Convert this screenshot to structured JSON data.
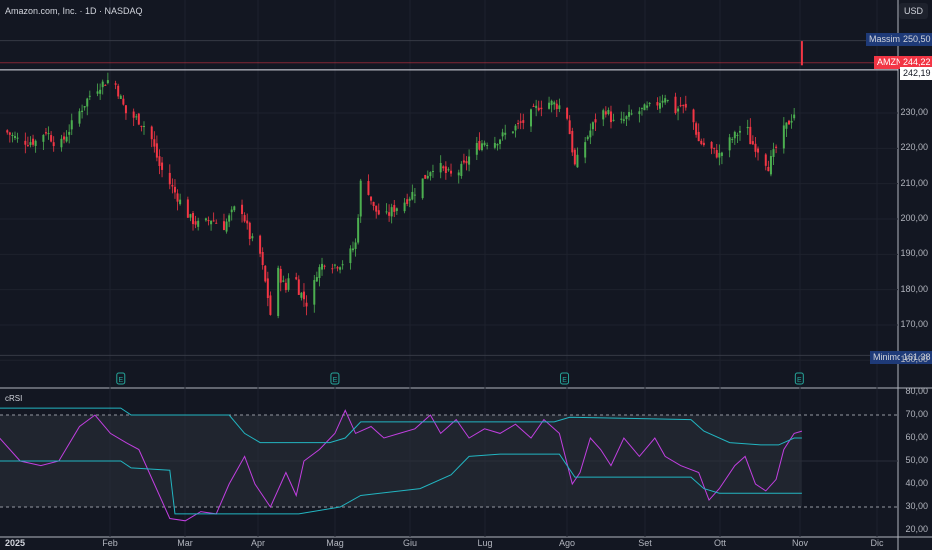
{
  "header": {
    "title": "Amazon.com, Inc. · 1D · NASDAQ",
    "currency": "USD"
  },
  "tags": {
    "high_label": "Massimo",
    "high_value": "250,50",
    "symbol": "AMZN",
    "last_value": "244,22",
    "prev_value": "242,19",
    "low_label": "Minimo",
    "low_value": "161,38"
  },
  "earnings_marker": "E",
  "indicator": {
    "name": "cRSI"
  },
  "colors": {
    "up": "#4caf50",
    "down": "#f23645",
    "crsi": "#c13fe0",
    "bands": "#22b5c1",
    "bg": "#131722"
  },
  "chart_data": [
    {
      "type": "candlestick",
      "title": "Amazon.com, Inc. · 1D · NASDAQ",
      "x_unit": "days since 2025-01-01 (approx)",
      "ylim": [
        158,
        254
      ],
      "y_ticks": [
        "230,00",
        "220,00",
        "210,00",
        "200,00",
        "190,00",
        "180,00",
        "170,00",
        "160,00"
      ],
      "x_ticks": [
        "2025",
        "Feb",
        "Mar",
        "Apr",
        "Mag",
        "Giu",
        "Lug",
        "Ago",
        "Set",
        "Ott",
        "Nov",
        "Dic"
      ],
      "close_path": [
        [
          -4,
          225
        ],
        [
          2,
          222
        ],
        [
          8,
          222
        ],
        [
          12,
          225
        ],
        [
          17,
          220
        ],
        [
          23,
          228
        ],
        [
          29,
          235
        ],
        [
          33,
          238
        ],
        [
          38,
          240
        ],
        [
          40,
          236
        ],
        [
          43,
          230
        ],
        [
          48,
          228
        ],
        [
          52,
          225
        ],
        [
          56,
          215
        ],
        [
          60,
          210
        ],
        [
          64,
          205
        ],
        [
          68,
          200
        ],
        [
          72,
          198
        ],
        [
          76,
          200
        ],
        [
          81,
          198
        ],
        [
          87,
          205
        ],
        [
          91,
          195
        ],
        [
          95,
          190
        ],
        [
          98,
          178
        ],
        [
          100,
          168
        ],
        [
          102,
          185
        ],
        [
          105,
          180
        ],
        [
          107,
          188
        ],
        [
          110,
          180
        ],
        [
          114,
          175
        ],
        [
          117,
          185
        ],
        [
          120,
          188
        ],
        [
          124,
          187
        ],
        [
          128,
          188
        ],
        [
          132,
          193
        ],
        [
          134,
          210
        ],
        [
          137,
          208
        ],
        [
          139,
          203
        ],
        [
          143,
          200
        ],
        [
          147,
          203
        ],
        [
          151,
          205
        ],
        [
          155,
          208
        ],
        [
          159,
          212
        ],
        [
          163,
          216
        ],
        [
          167,
          213
        ],
        [
          170,
          212
        ],
        [
          174,
          215
        ],
        [
          178,
          220
        ],
        [
          182,
          222
        ],
        [
          186,
          222
        ],
        [
          190,
          224
        ],
        [
          194,
          226
        ],
        [
          198,
          228
        ],
        [
          203,
          232
        ],
        [
          207,
          233
        ],
        [
          211,
          232
        ],
        [
          214,
          229
        ],
        [
          217,
          215
        ],
        [
          221,
          222
        ],
        [
          225,
          228
        ],
        [
          229,
          231
        ],
        [
          233,
          226
        ],
        [
          236,
          228
        ],
        [
          240,
          230
        ],
        [
          244,
          231
        ],
        [
          248,
          232
        ],
        [
          252,
          235
        ],
        [
          255,
          230
        ],
        [
          258,
          232
        ],
        [
          262,
          230
        ],
        [
          265,
          222
        ],
        [
          269,
          220
        ],
        [
          273,
          218
        ],
        [
          277,
          222
        ],
        [
          281,
          225
        ],
        [
          283,
          228
        ],
        [
          285,
          222
        ],
        [
          289,
          219
        ],
        [
          292,
          215
        ],
        [
          295,
          220
        ],
        [
          298,
          225
        ],
        [
          302,
          230
        ],
        [
          304,
          226
        ],
        [
          305,
          244.22
        ]
      ],
      "last_candle": {
        "open": 250.5,
        "high": 250.5,
        "low": 243.5,
        "close": 244.22
      },
      "high": 250.5,
      "low": 161.38,
      "prev_close": 242.19,
      "earnings_days": [
        41,
        124,
        213,
        304
      ]
    },
    {
      "type": "line",
      "title": "cRSI",
      "ylim": [
        18,
        82
      ],
      "y_ticks": [
        "80,00",
        "70,00",
        "60,00",
        "50,00",
        "40,00",
        "30,00",
        "20,00"
      ],
      "levels": [
        70,
        30
      ],
      "series": [
        {
          "name": "cRSI",
          "points": [
            [
              -6,
              60
            ],
            [
              2,
              50
            ],
            [
              10,
              48
            ],
            [
              17,
              50
            ],
            [
              25,
              65
            ],
            [
              31,
              70
            ],
            [
              37,
              62
            ],
            [
              43,
              58
            ],
            [
              48,
              55
            ],
            [
              54,
              40
            ],
            [
              60,
              25
            ],
            [
              66,
              24
            ],
            [
              72,
              28
            ],
            [
              78,
              27
            ],
            [
              83,
              40
            ],
            [
              89,
              52
            ],
            [
              93,
              40
            ],
            [
              99,
              30
            ],
            [
              105,
              45
            ],
            [
              109,
              35
            ],
            [
              112,
              50
            ],
            [
              118,
              55
            ],
            [
              124,
              62
            ],
            [
              128,
              72
            ],
            [
              132,
              62
            ],
            [
              138,
              65
            ],
            [
              143,
              60
            ],
            [
              149,
              62
            ],
            [
              155,
              64
            ],
            [
              161,
              70
            ],
            [
              165,
              62
            ],
            [
              171,
              68
            ],
            [
              176,
              60
            ],
            [
              182,
              64
            ],
            [
              188,
              62
            ],
            [
              194,
              66
            ],
            [
              200,
              60
            ],
            [
              205,
              68
            ],
            [
              211,
              62
            ],
            [
              216,
              40
            ],
            [
              219,
              45
            ],
            [
              223,
              60
            ],
            [
              227,
              55
            ],
            [
              231,
              48
            ],
            [
              236,
              60
            ],
            [
              242,
              52
            ],
            [
              248,
              60
            ],
            [
              252,
              52
            ],
            [
              258,
              48
            ],
            [
              265,
              45
            ],
            [
              269,
              33
            ],
            [
              273,
              38
            ],
            [
              279,
              48
            ],
            [
              283,
              52
            ],
            [
              287,
              40
            ],
            [
              291,
              37
            ],
            [
              295,
              42
            ],
            [
              298,
              55
            ],
            [
              302,
              62
            ],
            [
              305,
              63
            ]
          ]
        },
        {
          "name": "Upper band",
          "points": [
            [
              -6,
              73
            ],
            [
              41,
              73
            ],
            [
              45,
              70
            ],
            [
              60,
              70
            ],
            [
              83,
              70
            ],
            [
              89,
              62
            ],
            [
              95,
              58
            ],
            [
              101,
              58
            ],
            [
              122,
              58
            ],
            [
              128,
              60
            ],
            [
              134,
              67
            ],
            [
              139,
              67
            ],
            [
              209,
              67
            ],
            [
              215,
              69
            ],
            [
              262,
              68
            ],
            [
              267,
              63
            ],
            [
              277,
              58
            ],
            [
              289,
              57
            ],
            [
              296,
              57
            ],
            [
              302,
              60
            ],
            [
              305,
              60
            ]
          ]
        },
        {
          "name": "Lower band",
          "points": [
            [
              -6,
              50
            ],
            [
              41,
              50
            ],
            [
              45,
              47
            ],
            [
              60,
              46
            ],
            [
              62,
              27
            ],
            [
              79,
              27
            ],
            [
              110,
              27
            ],
            [
              126,
              30
            ],
            [
              134,
              35
            ],
            [
              157,
              38
            ],
            [
              169,
              44
            ],
            [
              176,
              52
            ],
            [
              188,
              53
            ],
            [
              211,
              53
            ],
            [
              217,
              43
            ],
            [
              262,
              43
            ],
            [
              267,
              38
            ],
            [
              273,
              36
            ],
            [
              305,
              36
            ]
          ]
        }
      ]
    }
  ]
}
